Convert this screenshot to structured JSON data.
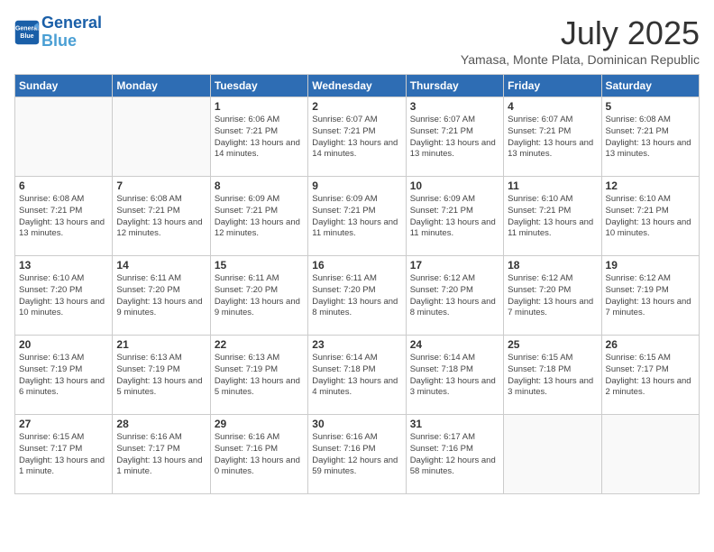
{
  "logo": {
    "line1": "General",
    "line2": "Blue"
  },
  "title": "July 2025",
  "location": "Yamasa, Monte Plata, Dominican Republic",
  "days_header": [
    "Sunday",
    "Monday",
    "Tuesday",
    "Wednesday",
    "Thursday",
    "Friday",
    "Saturday"
  ],
  "weeks": [
    [
      {
        "day": "",
        "info": ""
      },
      {
        "day": "",
        "info": ""
      },
      {
        "day": "1",
        "info": "Sunrise: 6:06 AM\nSunset: 7:21 PM\nDaylight: 13 hours and 14 minutes."
      },
      {
        "day": "2",
        "info": "Sunrise: 6:07 AM\nSunset: 7:21 PM\nDaylight: 13 hours and 14 minutes."
      },
      {
        "day": "3",
        "info": "Sunrise: 6:07 AM\nSunset: 7:21 PM\nDaylight: 13 hours and 13 minutes."
      },
      {
        "day": "4",
        "info": "Sunrise: 6:07 AM\nSunset: 7:21 PM\nDaylight: 13 hours and 13 minutes."
      },
      {
        "day": "5",
        "info": "Sunrise: 6:08 AM\nSunset: 7:21 PM\nDaylight: 13 hours and 13 minutes."
      }
    ],
    [
      {
        "day": "6",
        "info": "Sunrise: 6:08 AM\nSunset: 7:21 PM\nDaylight: 13 hours and 13 minutes."
      },
      {
        "day": "7",
        "info": "Sunrise: 6:08 AM\nSunset: 7:21 PM\nDaylight: 13 hours and 12 minutes."
      },
      {
        "day": "8",
        "info": "Sunrise: 6:09 AM\nSunset: 7:21 PM\nDaylight: 13 hours and 12 minutes."
      },
      {
        "day": "9",
        "info": "Sunrise: 6:09 AM\nSunset: 7:21 PM\nDaylight: 13 hours and 11 minutes."
      },
      {
        "day": "10",
        "info": "Sunrise: 6:09 AM\nSunset: 7:21 PM\nDaylight: 13 hours and 11 minutes."
      },
      {
        "day": "11",
        "info": "Sunrise: 6:10 AM\nSunset: 7:21 PM\nDaylight: 13 hours and 11 minutes."
      },
      {
        "day": "12",
        "info": "Sunrise: 6:10 AM\nSunset: 7:21 PM\nDaylight: 13 hours and 10 minutes."
      }
    ],
    [
      {
        "day": "13",
        "info": "Sunrise: 6:10 AM\nSunset: 7:20 PM\nDaylight: 13 hours and 10 minutes."
      },
      {
        "day": "14",
        "info": "Sunrise: 6:11 AM\nSunset: 7:20 PM\nDaylight: 13 hours and 9 minutes."
      },
      {
        "day": "15",
        "info": "Sunrise: 6:11 AM\nSunset: 7:20 PM\nDaylight: 13 hours and 9 minutes."
      },
      {
        "day": "16",
        "info": "Sunrise: 6:11 AM\nSunset: 7:20 PM\nDaylight: 13 hours and 8 minutes."
      },
      {
        "day": "17",
        "info": "Sunrise: 6:12 AM\nSunset: 7:20 PM\nDaylight: 13 hours and 8 minutes."
      },
      {
        "day": "18",
        "info": "Sunrise: 6:12 AM\nSunset: 7:20 PM\nDaylight: 13 hours and 7 minutes."
      },
      {
        "day": "19",
        "info": "Sunrise: 6:12 AM\nSunset: 7:19 PM\nDaylight: 13 hours and 7 minutes."
      }
    ],
    [
      {
        "day": "20",
        "info": "Sunrise: 6:13 AM\nSunset: 7:19 PM\nDaylight: 13 hours and 6 minutes."
      },
      {
        "day": "21",
        "info": "Sunrise: 6:13 AM\nSunset: 7:19 PM\nDaylight: 13 hours and 5 minutes."
      },
      {
        "day": "22",
        "info": "Sunrise: 6:13 AM\nSunset: 7:19 PM\nDaylight: 13 hours and 5 minutes."
      },
      {
        "day": "23",
        "info": "Sunrise: 6:14 AM\nSunset: 7:18 PM\nDaylight: 13 hours and 4 minutes."
      },
      {
        "day": "24",
        "info": "Sunrise: 6:14 AM\nSunset: 7:18 PM\nDaylight: 13 hours and 3 minutes."
      },
      {
        "day": "25",
        "info": "Sunrise: 6:15 AM\nSunset: 7:18 PM\nDaylight: 13 hours and 3 minutes."
      },
      {
        "day": "26",
        "info": "Sunrise: 6:15 AM\nSunset: 7:17 PM\nDaylight: 13 hours and 2 minutes."
      }
    ],
    [
      {
        "day": "27",
        "info": "Sunrise: 6:15 AM\nSunset: 7:17 PM\nDaylight: 13 hours and 1 minute."
      },
      {
        "day": "28",
        "info": "Sunrise: 6:16 AM\nSunset: 7:17 PM\nDaylight: 13 hours and 1 minute."
      },
      {
        "day": "29",
        "info": "Sunrise: 6:16 AM\nSunset: 7:16 PM\nDaylight: 13 hours and 0 minutes."
      },
      {
        "day": "30",
        "info": "Sunrise: 6:16 AM\nSunset: 7:16 PM\nDaylight: 12 hours and 59 minutes."
      },
      {
        "day": "31",
        "info": "Sunrise: 6:17 AM\nSunset: 7:16 PM\nDaylight: 12 hours and 58 minutes."
      },
      {
        "day": "",
        "info": ""
      },
      {
        "day": "",
        "info": ""
      }
    ]
  ]
}
